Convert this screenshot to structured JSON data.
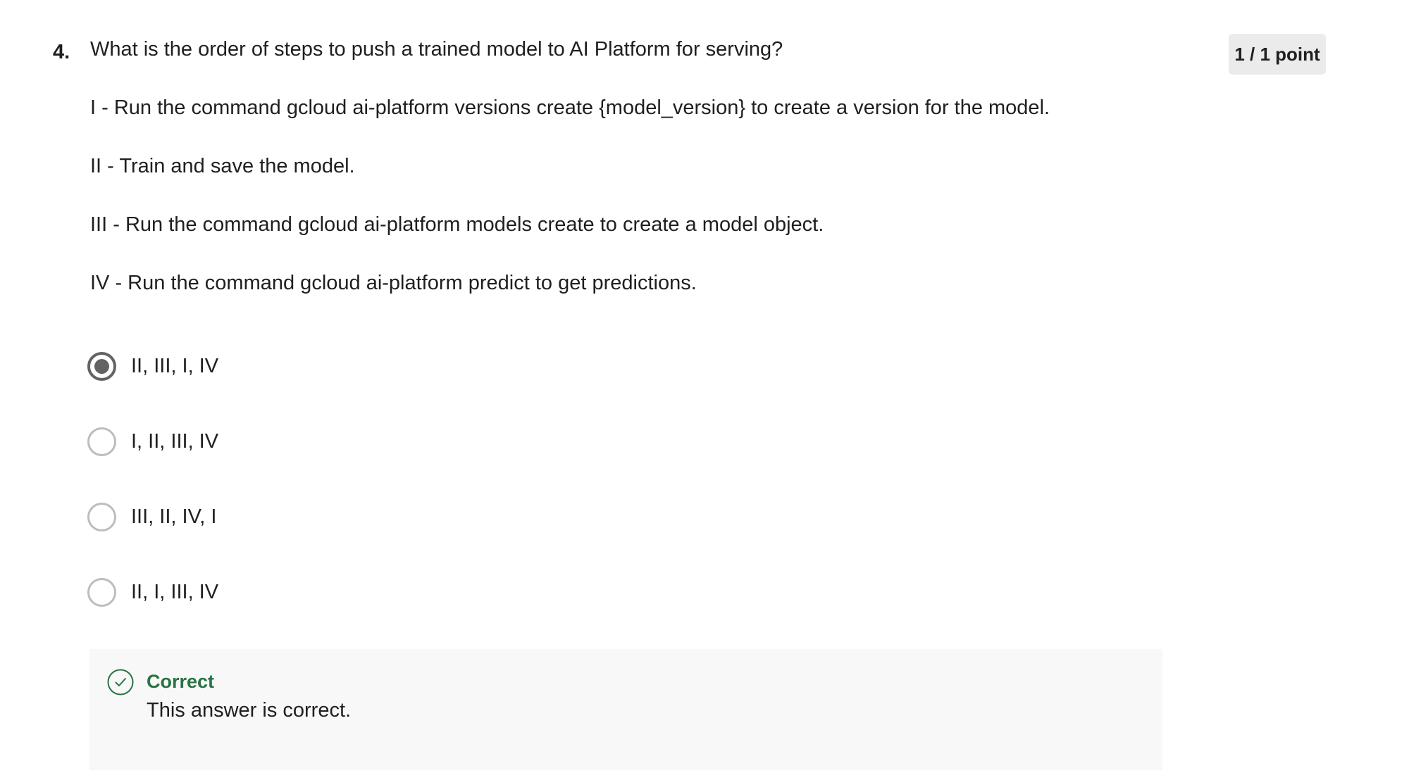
{
  "question": {
    "number": "4.",
    "text": "What is the order of steps to push a trained model to AI Platform for serving?",
    "points": "1 / 1 point",
    "steps": [
      "I - Run the command gcloud ai-platform versions create {model_version} to create a version for the model.",
      "II - Train and save the model.",
      "III - Run the command gcloud ai-platform models create to create a model object.",
      "IV - Run the command gcloud ai-platform predict to get predictions."
    ],
    "options": [
      {
        "label": "II, III, I, IV",
        "selected": true
      },
      {
        "label": "I, II, III, IV",
        "selected": false
      },
      {
        "label": "III, II, IV, I",
        "selected": false
      },
      {
        "label": "II, I, III, IV",
        "selected": false
      }
    ]
  },
  "feedback": {
    "title": "Correct",
    "text": "This answer is correct.",
    "icon": "check-circle-icon",
    "color": "#2a7346"
  }
}
